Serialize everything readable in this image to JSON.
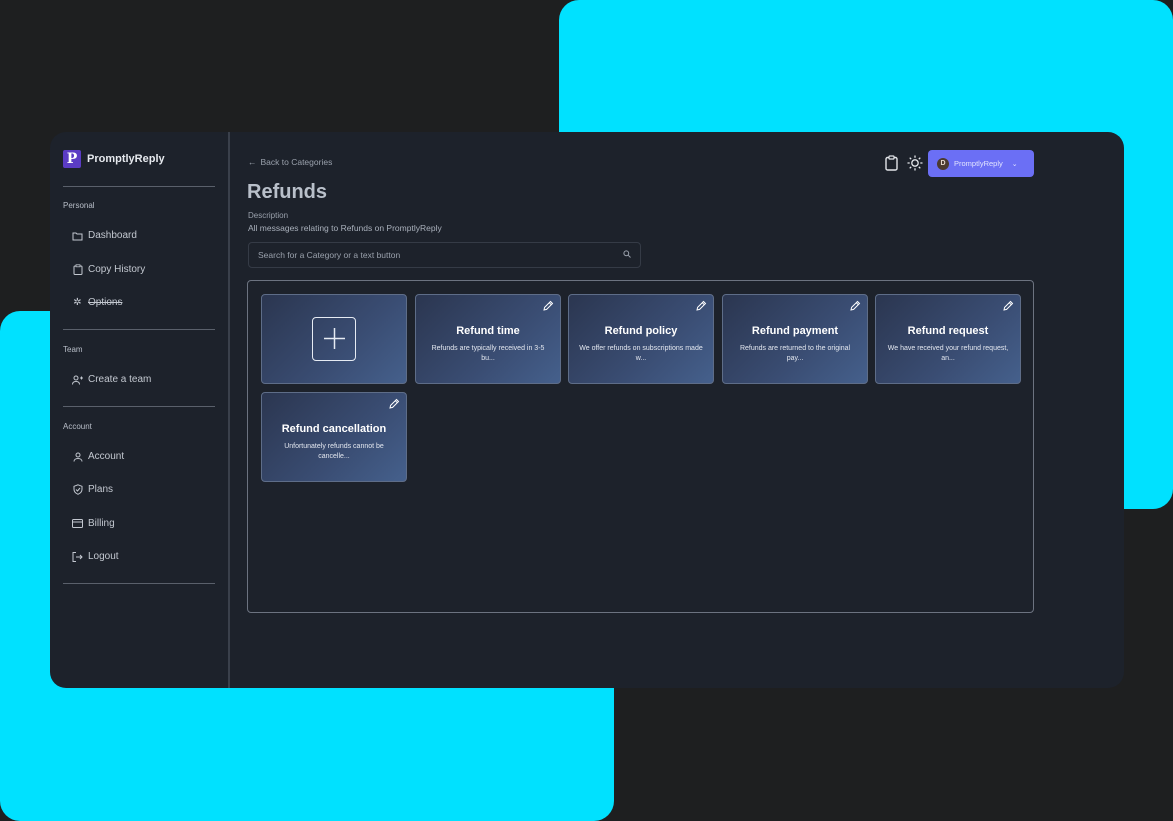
{
  "colors": {
    "accent_cyan": "#00e1ff",
    "user_button": "#6b6ff5",
    "brand_purple": "#5b3cc4"
  },
  "brand": {
    "logo_letter": "P",
    "name": "PromptlyReply"
  },
  "sidebar": {
    "sections": [
      {
        "title": "Personal",
        "items": [
          {
            "label": "Dashboard",
            "icon": "folder-icon"
          },
          {
            "label": "Copy History",
            "icon": "clipboard-icon"
          },
          {
            "label": "Options",
            "icon": "gear-icon"
          }
        ]
      },
      {
        "title": "Team",
        "items": [
          {
            "label": "Create a team",
            "icon": "user-plus-icon"
          }
        ]
      },
      {
        "title": "Account",
        "items": [
          {
            "label": "Account",
            "icon": "user-icon"
          },
          {
            "label": "Plans",
            "icon": "shield-icon"
          },
          {
            "label": "Billing",
            "icon": "credit-card-icon"
          },
          {
            "label": "Logout",
            "icon": "logout-icon"
          }
        ]
      }
    ]
  },
  "header": {
    "back_link": "Back to Categories",
    "title": "Refunds",
    "description_label": "Description",
    "description": "All messages relating to Refunds on PromptlyReply",
    "search_placeholder": "Search for a Category or a text button",
    "user": {
      "initial": "D",
      "name": "PromptlyReply"
    }
  },
  "cards": [
    {
      "title": "Refund time",
      "snippet": "Refunds are typically received in 3-5 bu..."
    },
    {
      "title": "Refund policy",
      "snippet": "We offer refunds on subscriptions made w..."
    },
    {
      "title": "Refund payment",
      "snippet": "Refunds are returned to the original pay..."
    },
    {
      "title": "Refund request",
      "snippet": "We have received your refund request, an..."
    },
    {
      "title": "Refund cancellation",
      "snippet": "Unfortunately refunds cannot be cancelle..."
    }
  ]
}
